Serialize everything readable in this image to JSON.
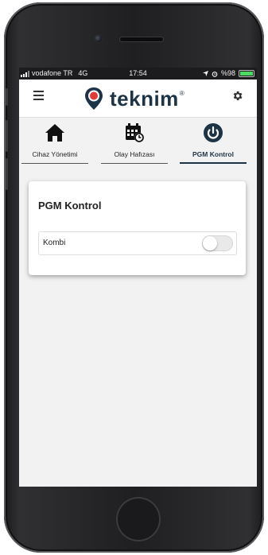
{
  "status_bar": {
    "carrier": "vodafone TR",
    "network": "4G",
    "time": "17:54",
    "battery_text": "%98"
  },
  "header": {
    "brand": "teknim",
    "brand_mark": "®",
    "menu_icon": "hamburger-menu-icon",
    "settings_icon": "gear-icon"
  },
  "tabs": [
    {
      "label": "Cihaz Yönetimi",
      "icon": "home-icon",
      "active": false
    },
    {
      "label": "Olay Hafızası",
      "icon": "calendar-clock-icon",
      "active": false
    },
    {
      "label": "PGM Kontrol",
      "icon": "power-icon",
      "active": true
    }
  ],
  "pgm_card": {
    "title": "PGM Kontrol",
    "items": [
      {
        "label": "Kombi",
        "state": "off"
      }
    ]
  },
  "colors": {
    "brand_navy": "#1d3346",
    "brand_red": "#e53935",
    "toggle_off": "#e9e9e9"
  }
}
